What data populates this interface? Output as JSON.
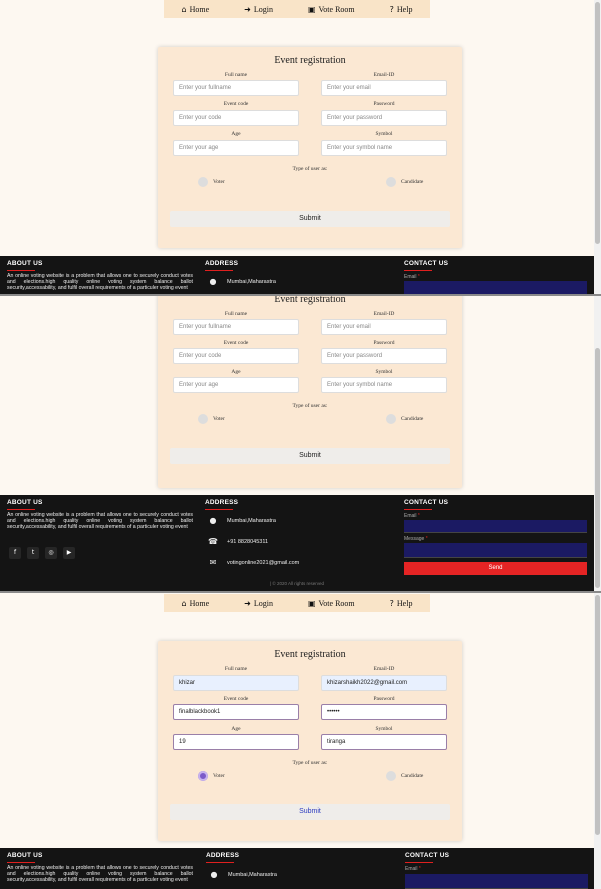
{
  "nav": {
    "items": [
      {
        "icon": "home-icon",
        "glyph": "⌂",
        "label": "Home"
      },
      {
        "icon": "login-icon",
        "glyph": "➜",
        "label": "Login"
      },
      {
        "icon": "vote-room-icon",
        "glyph": "▣",
        "label": "Vote Room"
      },
      {
        "icon": "help-icon",
        "glyph": "?",
        "label": "Help"
      }
    ]
  },
  "form": {
    "title": "Event registration",
    "labels": {
      "fullname": "Full name",
      "email": "Email-ID",
      "eventcode": "Event code",
      "password": "Password",
      "age": "Age",
      "symbol": "Symbol"
    },
    "placeholders": {
      "fullname": "Enter your fullname",
      "email": "Enter your email",
      "eventcode": "Enter your code",
      "password": "Enter your password",
      "age": "Enter your age",
      "symbol": "Enter your symbol name"
    },
    "user_type_label": "Type of user as:",
    "voter_label": "Voter",
    "candidate_label": "Candidate",
    "submit_label": "Submit",
    "filled": {
      "fullname": "khizar",
      "email": "khizarshaikh2022@gmail.com",
      "eventcode": "finalblackbook1",
      "password": "••••••",
      "age": "19",
      "symbol": "tiranga"
    }
  },
  "footer": {
    "about_heading": "ABOUT US",
    "about_text": "An online voting website is a problem that allows one to securely conduct votes and elections.high quality online voting system balance ballot security,accessability, and fulfil overall requirements of a particuler voting event",
    "address_heading": "ADDRESS",
    "address": "Mumbai,Maharastra",
    "phone": "+91 8828045311",
    "email": "votingonline2021@gmail.com",
    "contact_heading": "CONTACT US",
    "contact_email_label": "Email",
    "contact_message_label": "Message",
    "required_mark": "*",
    "send_label": "Send",
    "copyright": "| © 2020 All rights reserved"
  },
  "colors": {
    "nav_bg": "#f9e4c8",
    "card_bg": "#fbe8d3",
    "footer_bg": "#141414",
    "accent_red": "#e52424",
    "field_navy": "#1b1a63",
    "radio_checked": "#7b5ac9"
  }
}
